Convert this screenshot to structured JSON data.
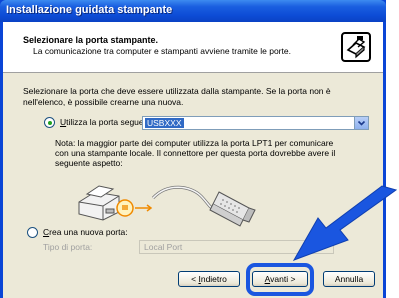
{
  "window": {
    "title": "Installazione guidata stampante"
  },
  "header": {
    "title": "Selezionare la porta stampante.",
    "subtitle": "La comunicazione tra computer e stampanti avviene tramite le porte.",
    "icon": "printer-port-icon"
  },
  "intro": "Selezionare la porta che deve essere utilizzata dalla stampante. Se la porta non è nell'elenco, è possibile crearne una nuova.",
  "use_port": {
    "label_underlined": "U",
    "label_rest": "tilizza la porta seguente:",
    "selected": true,
    "value": "USBXXX"
  },
  "note": "Nota: la maggior parte dei computer utilizza la porta LPT1 per comunicare con una stampante locale. Il connettore per questa porta dovrebbe avere il seguente aspetto:",
  "new_port": {
    "label_underlined": "C",
    "label_rest": "rea una nuova porta:",
    "selected": false,
    "type_label": "Tipo di porta:",
    "type_value": "Local Port"
  },
  "buttons": {
    "back_prefix": "< ",
    "back_underlined": "I",
    "back_rest": "ndietro",
    "next_underlined": "A",
    "next_rest": "vanti >",
    "cancel": "Annulla"
  },
  "colors": {
    "highlight": "#1a56e0",
    "arrow": "#1a56e0",
    "title_bar": "#0d4cd6"
  }
}
